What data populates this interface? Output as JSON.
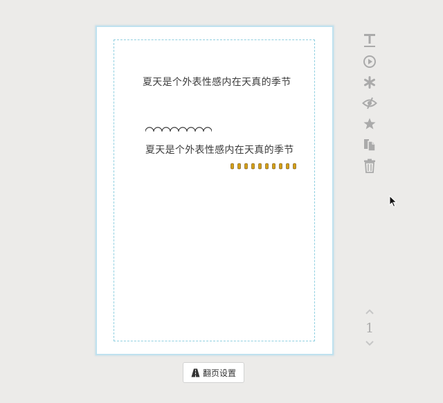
{
  "canvas": {
    "text_top": "夏天是个外表性感内在天真的季节",
    "text_bottom": "夏天是个外表性感内在天真的季节"
  },
  "toolbar": {
    "icons": [
      "text-icon",
      "play-icon",
      "asterisk-icon",
      "eye-icon",
      "star-icon",
      "copy-icon",
      "trash-icon"
    ]
  },
  "pager": {
    "current_page": "1"
  },
  "footer": {
    "flip_settings_label": "翻页设置"
  },
  "colors": {
    "background": "#ecebe9",
    "page_border": "#bfe1ef",
    "safe_area_border": "#8fcfe0",
    "icon": "#aaaaaa",
    "text": "#3c3c3c",
    "bead_gold": "#d4a017"
  }
}
